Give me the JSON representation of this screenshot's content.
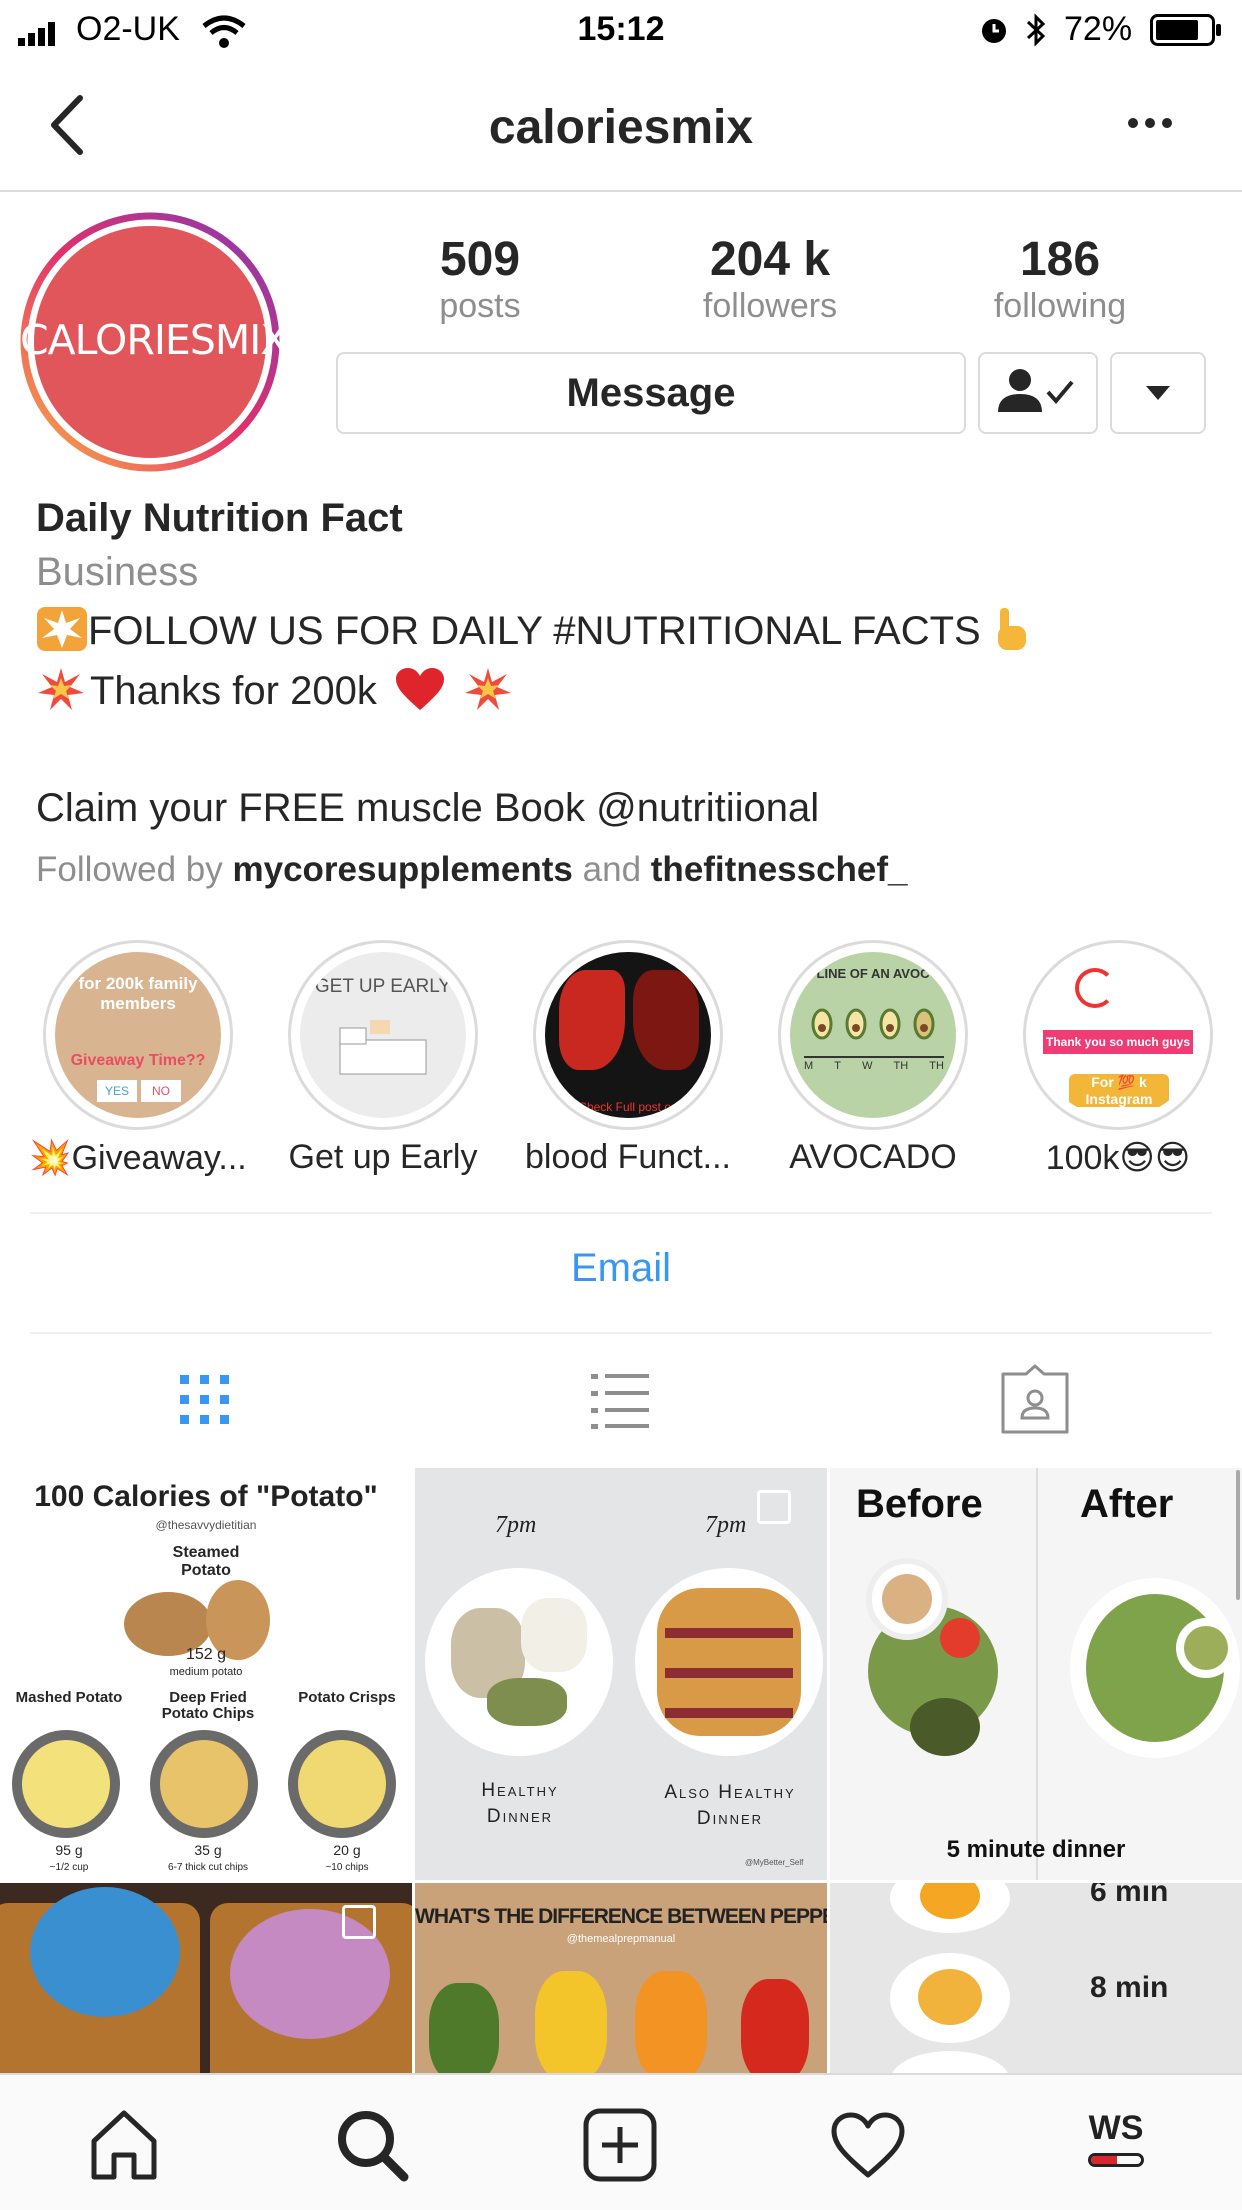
{
  "status_bar": {
    "carrier": "O2-UK",
    "time": "15:12",
    "battery": "72%"
  },
  "nav": {
    "title": "caloriesmix",
    "back_icon": "chevron-left-icon",
    "more_icon": "more-horizontal-icon"
  },
  "profile": {
    "avatar_text": "CALORIESMIX",
    "stats": [
      {
        "value": "509",
        "label": "posts"
      },
      {
        "value": "204 k",
        "label": "followers"
      },
      {
        "value": "186",
        "label": "following"
      }
    ],
    "message_label": "Message",
    "name": "Daily Nutrition Fact",
    "category": "Business",
    "bio_line1": "FOLLOW US FOR DAILY #NUTRITIONAL FACTS",
    "bio_line2": "Thanks for 200k",
    "bio_line3": "Claim your FREE muscle Book @nutritiional",
    "followed_by_prefix": "Followed by",
    "followed_by_user1": "mycoresupplements",
    "followed_by_and": "and",
    "followed_by_user2": "thefitnesschef_"
  },
  "highlights": [
    {
      "label": "💥Giveaway...",
      "cover_text": "for 200k family members",
      "cover_sub": "Giveaway Time??",
      "yes": "YES",
      "no": "NO"
    },
    {
      "label": "Get up Early",
      "cover_text": "GET UP EARLY"
    },
    {
      "label": "blood Funct...",
      "cover_text": "Check Full post on"
    },
    {
      "label": "AVOCADO",
      "cover_text": "LINE OF AN AVOC",
      "days": [
        "M",
        "T",
        "W",
        "TH",
        "TH"
      ]
    },
    {
      "label": "100k😎😎",
      "cover_text": "Thank you so much guys",
      "cover_sub": "For 💯 k Instagram"
    }
  ],
  "contact": {
    "email_label": "Email"
  },
  "tabs": [
    "grid-icon",
    "list-icon",
    "tagged-icon"
  ],
  "posts": [
    {
      "title": "100 Calories of \"Potato\"",
      "handle": "@thesavvydietitian",
      "top_label": "Steamed Potato",
      "top_weight": "152 g",
      "top_note": "medium potato",
      "items": [
        {
          "name": "Mashed Potato",
          "weight": "95 g",
          "note": "~1/2 cup"
        },
        {
          "name": "Deep Fried Potato Chips",
          "weight": "35 g",
          "note": "6-7 thick cut chips"
        },
        {
          "name": "Potato Crisps",
          "weight": "20 g",
          "note": "~10 chips"
        }
      ]
    },
    {
      "left_time": "7pm",
      "right_time": "7pm",
      "left_caption": "Healthy Dinner",
      "right_caption": "Also Healthy Dinner",
      "credit": "@MyBetter_Self"
    },
    {
      "before": "Before",
      "after": "After",
      "caption": "5 minute dinner"
    },
    {
      "caption": ""
    },
    {
      "title": "WHAT'S THE DIFFERENCE BETWEEN PEPPERS?",
      "handle": "@themealprepmanual"
    },
    {
      "label1": "6 min",
      "label2": "8 min"
    }
  ],
  "tab_bar": [
    "home-icon",
    "search-icon",
    "add-post-icon",
    "heart-icon",
    "profile-avatar-icon"
  ],
  "tab_bar_avatar_text": "WS",
  "colors": {
    "link_blue": "#3897f0",
    "avatar_red": "#e0565b",
    "active_tab": "#3897f0"
  }
}
